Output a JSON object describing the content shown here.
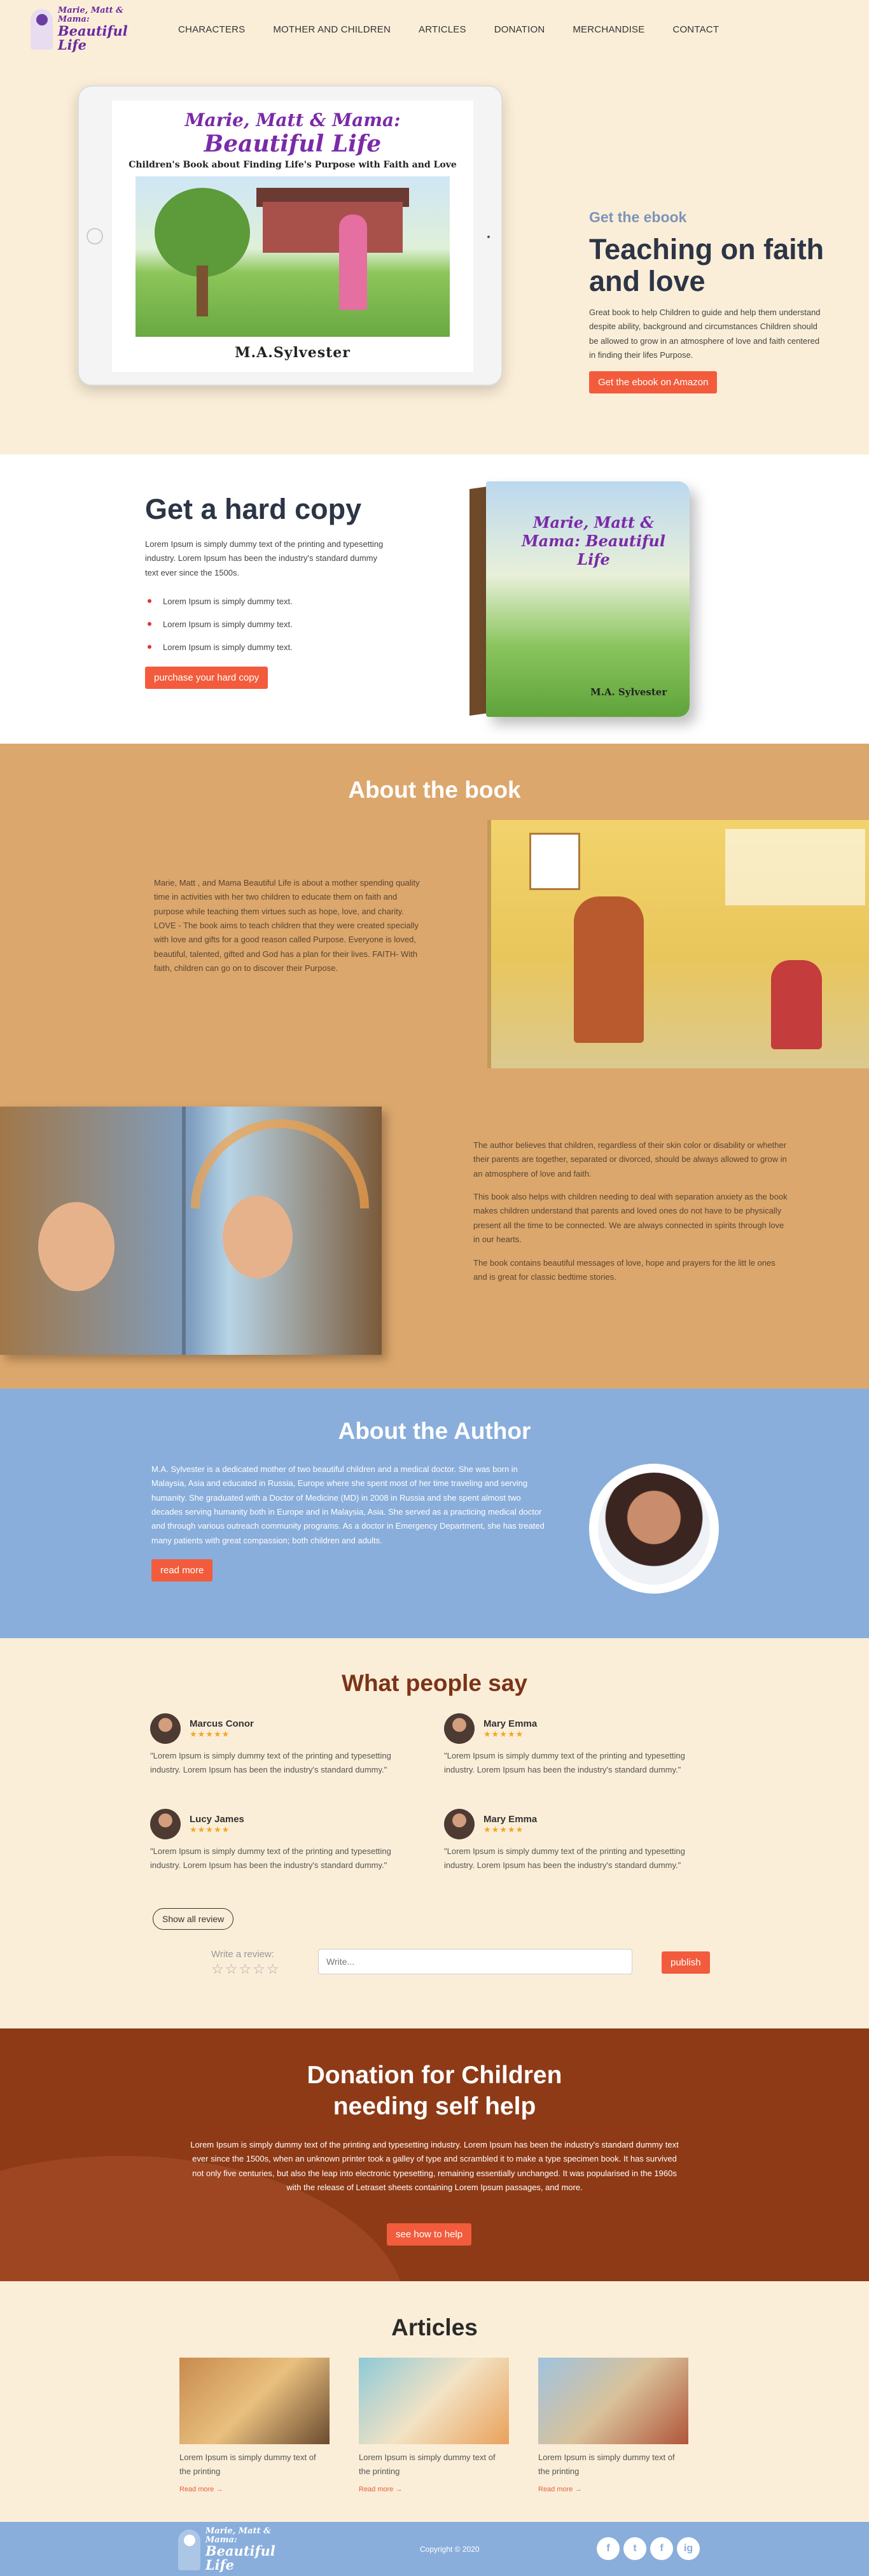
{
  "header": {
    "logo_line1": "Marie, Matt & Mama:",
    "logo_line2": "Beautiful Life",
    "nav": [
      "CHARACTERS",
      "MOTHER AND CHILDREN",
      "ARTICLES",
      "DONATION",
      "MERCHANDISE",
      "CONTACT"
    ]
  },
  "hero": {
    "cover_title1": "Marie, Matt & Mama:",
    "cover_title2": "Beautiful Life",
    "cover_sub": "Children's Book about Finding Life's Purpose with Faith and Love",
    "cover_author": "M.A.Sylvester",
    "kicker": "Get the ebook",
    "title": "Teaching on faith and love",
    "text": "Great book to help Children to guide and help them understand despite ability, background and circumstances Children should be allowed to grow in an atmosphere of love and faith centered in finding their lifes Purpose.",
    "button": "Get the ebook on Amazon"
  },
  "hardcopy": {
    "title": "Get a hard copy",
    "text": "Lorem Ipsum is simply dummy text of the printing and typesetting industry. Lorem Ipsum has been the industry's standard dummy text ever since the 1500s.",
    "bullets": [
      "Lorem Ipsum is simply dummy text.",
      "Lorem Ipsum is simply dummy text.",
      "Lorem Ipsum is simply dummy text."
    ],
    "button": "purchase your hard copy",
    "book_title": "Marie, Matt & Mama: Beautiful Life",
    "book_author": "M.A. Sylvester"
  },
  "about_book": {
    "title": "About the book",
    "text1": "Marie, Matt , and Mama Beautiful Life is about a mother spending quality time in activities with her two children to educate them on faith and purpose while teaching them virtues such as hope, love, and charity. LOVE - The book aims to teach children that they were created specially with love and gifts for a good reason called Purpose. Everyone is loved, beautiful, talented, gifted and God has a plan for their lives. FAITH- With faith, children can go on to discover their Purpose.",
    "text2": "The author believes that children, regardless of their skin color or disability or whether their parents are together, separated or divorced, should be always allowed to grow in an atmosphere of love and faith.",
    "text3": "This book also helps with children needing to deal with separation anxiety as the book makes children understand that parents and loved ones do not have to be physically present all the time to be connected. We are always connected in spirits through love in our hearts.",
    "text4": "The book contains beautiful messages of love, hope and prayers for the litt le ones and is great for classic bedtime stories."
  },
  "author": {
    "title": "About the Author",
    "text": "M.A. Sylvester is a dedicated mother of two beautiful children and a medical doctor. She was born in Malaysia, Asia and educated in Russia, Europe where she spent most of her time traveling and serving humanity. She graduated with a Doctor of Medicine (MD) in 2008 in Russia and she spent almost two decades serving humanity both in Europe and in Malaysia, Asia. She served as a practicing medical doctor and through various outreach community programs. As a doctor in Emergency Department, she has treated many patients with great compassion; both children and adults.",
    "button": "read more"
  },
  "reviews": {
    "title": "What people say",
    "items": [
      {
        "name": "Marcus Conor",
        "stars": "★★★★★",
        "text": "\"Lorem Ipsum is simply dummy text of the printing and typesetting industry. Lorem Ipsum has been the industry's standard dummy.\""
      },
      {
        "name": "Mary Emma",
        "stars": "★★★★★",
        "text": "\"Lorem Ipsum is simply dummy text of the printing and typesetting industry. Lorem Ipsum has been the industry's standard dummy.\""
      },
      {
        "name": "Lucy James",
        "stars": "★★★★★",
        "text": "\"Lorem Ipsum is simply dummy text of the printing and typesetting industry. Lorem Ipsum has been the industry's standard dummy.\""
      },
      {
        "name": "Mary Emma",
        "stars": "★★★★★",
        "text": "\"Lorem Ipsum is simply dummy text of the printing and typesetting industry. Lorem Ipsum has been the industry's standard dummy.\""
      }
    ],
    "show_all": "Show all review",
    "write_label": "Write a review:",
    "empty_stars": "☆☆☆☆☆",
    "input_placeholder": "Write...",
    "publish": "publish"
  },
  "donation": {
    "title_line1": "Donation for Children",
    "title_line2": "needing self help",
    "text": "Lorem Ipsum is simply dummy text of the printing and typesetting industry. Lorem Ipsum has been the industry's standard dummy text ever since the 1500s, when an unknown printer took a galley of type and scrambled it to make a type specimen book. It has survived not only five centuries, but also the leap into electronic typesetting, remaining essentially unchanged. It was popularised in the 1960s with the release of Letraset sheets containing Lorem Ipsum passages, and more.",
    "button": "see how to help"
  },
  "articles": {
    "title": "Articles",
    "items": [
      {
        "text": "Lorem Ipsum is simply dummy text of the printing",
        "more": "Read more →"
      },
      {
        "text": "Lorem Ipsum is simply dummy text of the printing",
        "more": "Read more →"
      },
      {
        "text": "Lorem Ipsum is simply dummy text of the printing",
        "more": "Read more →"
      }
    ]
  },
  "footer": {
    "logo_line1": "Marie, Matt & Mama:",
    "logo_line2": "Beautiful Life",
    "copyright": "Copyright © 2020",
    "socials": [
      "f",
      "t",
      "f",
      "ig"
    ]
  },
  "colors": {
    "accent": "#f25c3c",
    "cream": "#fbeed8",
    "tan": "#dca76c",
    "blue": "#89aedb",
    "rust": "#8e3a16"
  }
}
